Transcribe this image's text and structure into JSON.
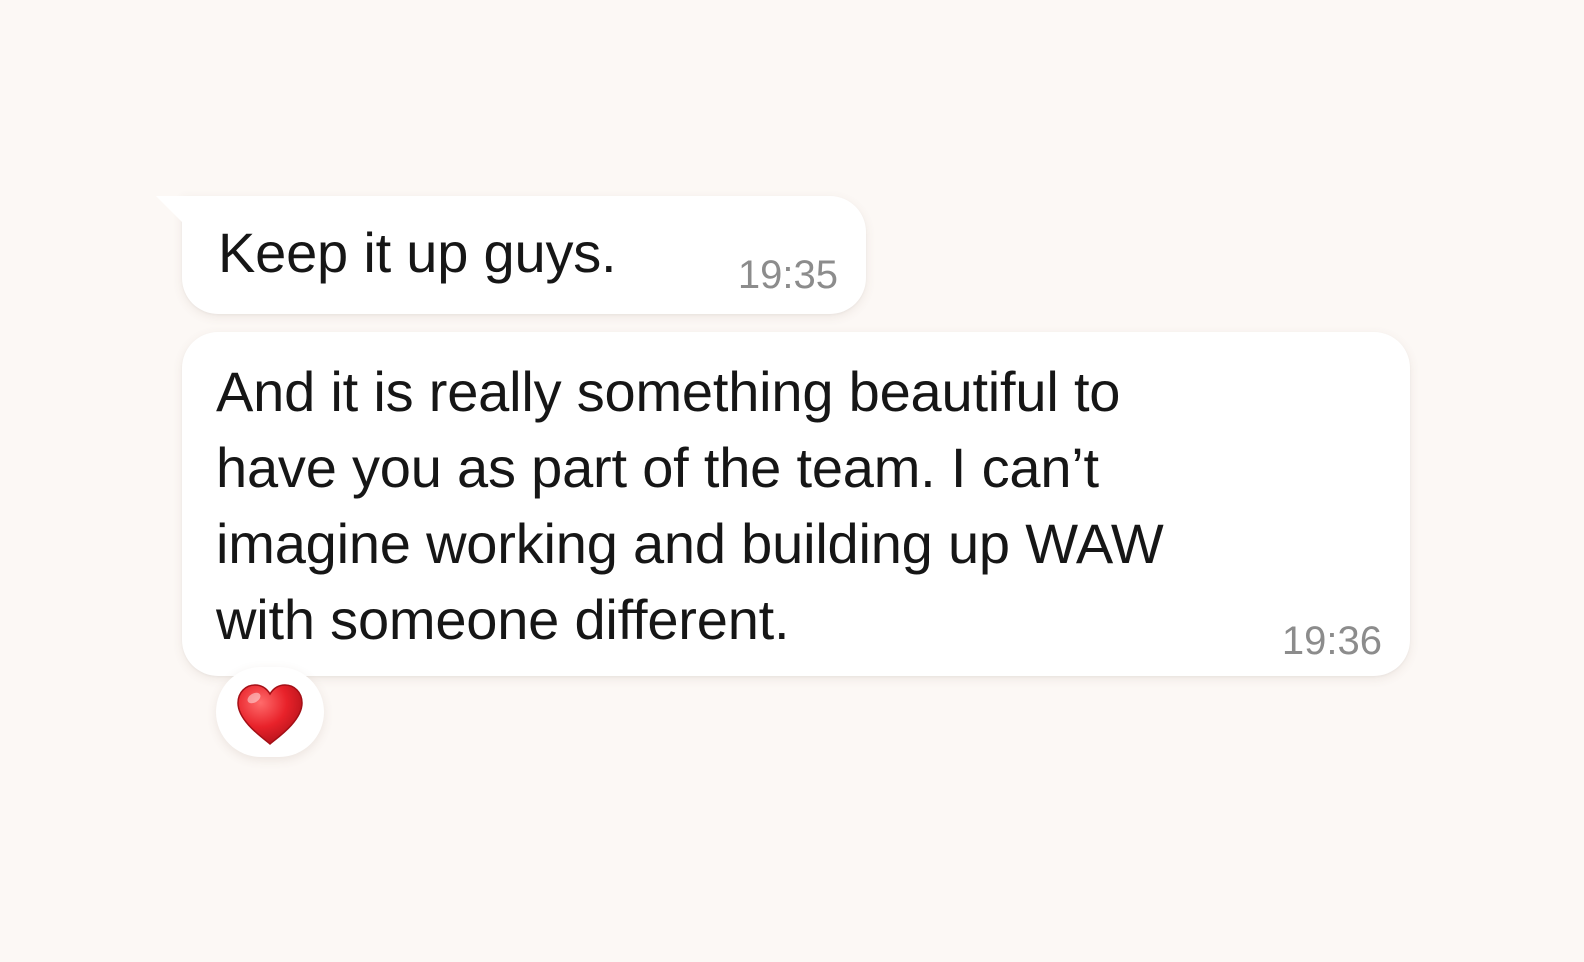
{
  "messages": [
    {
      "text": "Keep it up guys.",
      "time": "19:35"
    },
    {
      "lines": [
        "And it is really something beautiful to",
        "have you as part of the team. I can’t",
        "imagine working and building up WAW",
        "with someone different."
      ],
      "time": "19:36",
      "reaction": {
        "icon": "heart-icon",
        "emoji": "❤️",
        "color": "#e11d24"
      }
    }
  ],
  "colors": {
    "background": "#fcf8f5",
    "bubble": "#ffffff",
    "text": "#161616",
    "timestamp": "#8c8c8c"
  }
}
